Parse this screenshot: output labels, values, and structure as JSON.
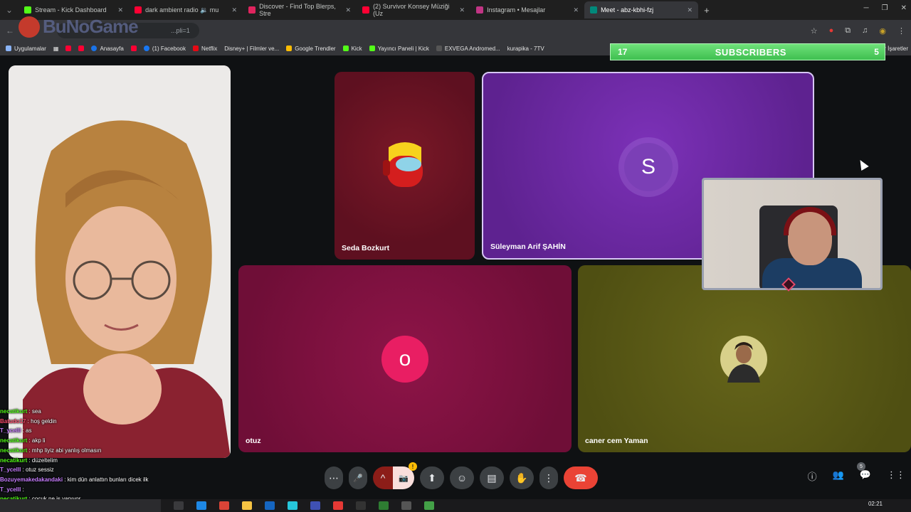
{
  "tabs": [
    {
      "title": "Stream - Kick Dashboard",
      "color": "#53fc18",
      "active": false
    },
    {
      "title": "dark ambient radio 🔉 mu",
      "color": "#ff0033",
      "active": false
    },
    {
      "title": "Discover - Find Top Blerps, Stre",
      "color": "#e0245e",
      "active": false
    },
    {
      "title": "(2) Survivor Konsey Müziği (Uz",
      "color": "#ff0033",
      "active": false
    },
    {
      "title": "Instagram • Mesajlar",
      "color": "#c13584",
      "active": false
    },
    {
      "title": "Meet - abz-kbhi-fzj",
      "color": "#00897b",
      "active": true
    }
  ],
  "address": {
    "url": "...pli=1",
    "logo_text": "BuNoGame"
  },
  "bookmarks": [
    {
      "label": "Uygulamalar",
      "color": "#8ab4f8"
    },
    {
      "label": "",
      "color": "#ff0033"
    },
    {
      "label": "",
      "color": "#ff0033"
    },
    {
      "label": "Anasayfa",
      "color": "#1a73e8"
    },
    {
      "label": "",
      "color": "#ff0033"
    },
    {
      "label": "(1) Facebook",
      "color": "#1877f2"
    },
    {
      "label": "Netflix",
      "color": "#e50914"
    },
    {
      "label": "Disney+ | Filmler ve...",
      "color": "#113ccf"
    },
    {
      "label": "Google Trendler",
      "color": "#fbbc04"
    },
    {
      "label": "Kick",
      "color": "#53fc18"
    },
    {
      "label": "Yayıncı Paneli | Kick",
      "color": "#53fc18"
    },
    {
      "label": "EXVEGA Andromed...",
      "color": "#555555"
    },
    {
      "label": "kurapika - 7TV",
      "color": "#29b6f6"
    }
  ],
  "bookmarks_right": "r İşaretler",
  "subscribers": {
    "left_count": "17",
    "label": "SUBSCRIBERS",
    "right_count": "5"
  },
  "participants": {
    "seda": {
      "name": "Seda Bozkurt"
    },
    "suleyman": {
      "name": "Süleyman Arif ŞAHİN",
      "initial": "S"
    },
    "otuz": {
      "name": "otuz",
      "initial": "o"
    },
    "caner": {
      "name": "caner cem Yaman"
    }
  },
  "controls": {
    "more": "⋯",
    "mic": "🎤",
    "mic_up": "^",
    "cam": "📷",
    "cam_badge": "!",
    "present": "⬆",
    "emoji": "☺",
    "captions": "▤",
    "hand": "✋",
    "options": "⋮",
    "leave": "☎"
  },
  "right_controls": {
    "info": "ⓘ",
    "people": "👥",
    "people_badge": "5",
    "chat": "💬",
    "activities": "⋮⋮"
  },
  "chat": [
    {
      "user": "necatikurt",
      "color": "#53fc18",
      "text": " : sea"
    },
    {
      "user": "Batudo17",
      "color": "#ff4d6d",
      "text": " : hoş geldin"
    },
    {
      "user": "T_ycelll",
      "color": "#c77dff",
      "text": " : as"
    },
    {
      "user": "necatikurt",
      "color": "#53fc18",
      "text": " : akp li"
    },
    {
      "user": "necatikurt",
      "color": "#53fc18",
      "text": " : mhp liyiz abi yanlış olmasın"
    },
    {
      "user": "necatikurt",
      "color": "#53fc18",
      "text": " : düzeltelim"
    },
    {
      "user": "T_ycelll",
      "color": "#c77dff",
      "text": " : otuz sessiz"
    },
    {
      "user": "Bozuyemakedakandaki",
      "color": "#c77dff",
      "text": " : kim dün anlattın bunları dicek ilk"
    },
    {
      "user": "T_ycelll",
      "color": "#c77dff",
      "text": " :"
    },
    {
      "user": "necatikurt",
      "color": "#53fc18",
      "text": " : çocuk ne iş yapıyor"
    }
  ],
  "clock": "02:21"
}
